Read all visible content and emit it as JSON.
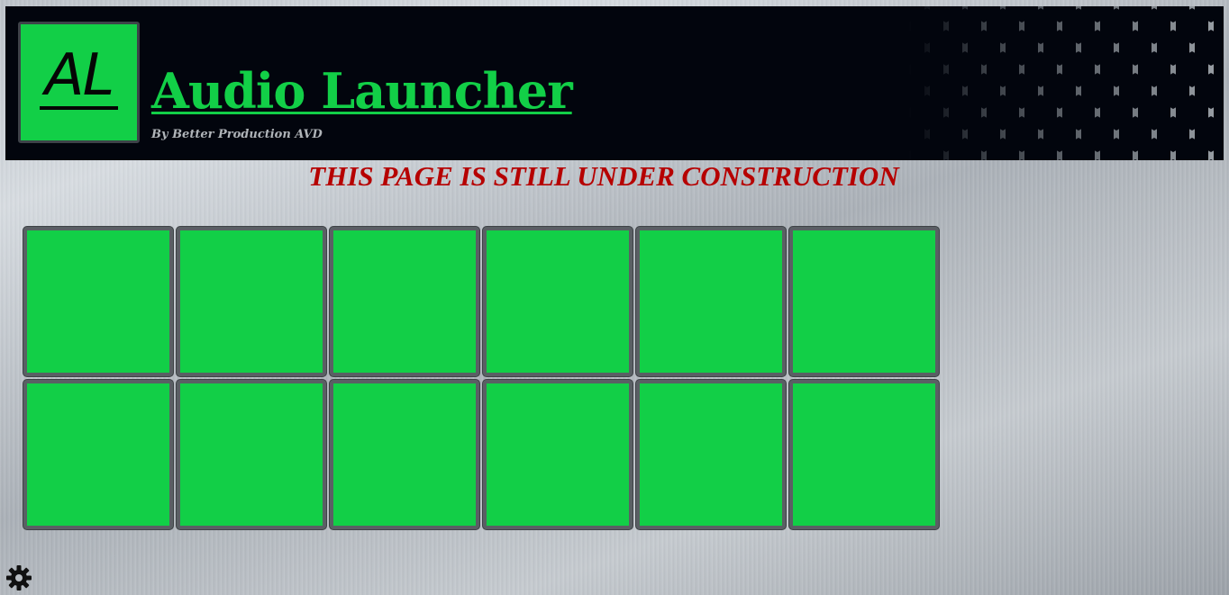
{
  "header": {
    "logo_text": "AL",
    "title": "Audio Launcher",
    "subtitle": "By Better Production AVD"
  },
  "notice": "THIS PAGE IS STILL UNDER CONSTRUCTION",
  "launcher": {
    "rows": 2,
    "columns": 6,
    "pad_color": "#12cf47"
  },
  "footer": {
    "settings_icon": "gear-icon"
  },
  "colors": {
    "accent": "#12cf47",
    "header_bg": "#02050d",
    "notice": "#b60000"
  }
}
